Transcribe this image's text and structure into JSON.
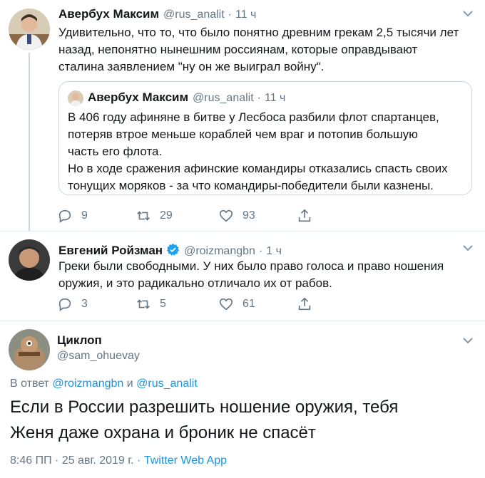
{
  "tweet1": {
    "name": "Авербух Максим",
    "handle": "@rus_analit",
    "time": "11 ч",
    "lines": [
      "Удивительно, что то, что было понятно древним грекам 2,5 тысячи лет",
      "назад, непонятно нынешним россиянам, которые оправдывают",
      "сталина заявлением \"ну он же выиграл войну\"."
    ],
    "quote": {
      "name": "Авербух Максим",
      "handle": "@rus_analit",
      "time": "11 ч",
      "lines": [
        "В 406 году афиняне в битве у Лесбоса разбили флот спартанцев,",
        "потеряв втрое меньше кораблей чем враг и потопив большую",
        "часть его флота.",
        "Но в ходе сражения афинские командиры отказались спасть своих",
        "тонущих моряков - за что командиры-победители были казнены."
      ]
    },
    "replies": "9",
    "retweets": "29",
    "likes": "93"
  },
  "tweet2": {
    "name": "Евгений Ройзман",
    "handle": "@roizmangbn",
    "time": "1 ч",
    "lines": [
      "Греки были свободными. У них было право голоса и право ношения",
      "оружия, и это радикально отличало их от рабов."
    ],
    "replies": "3",
    "retweets": "5",
    "likes": "61"
  },
  "tweet3": {
    "name": "Циклоп",
    "handle": "@sam_ohuevay",
    "reply_prefix": "В ответ",
    "reply_mention1": "@roizmangbn",
    "reply_and": "и",
    "reply_mention2": "@rus_analit",
    "lines": [
      "Если в России разрешить ношение оружия, тебя",
      "Женя даже охрана и броник не спасёт"
    ],
    "timestamp": "8:46 ПП · 25 авг. 2019 г. ·",
    "app": "Twitter Web App"
  },
  "colors": {
    "accent": "#1b95e0",
    "verified": "#1da1f2",
    "secondary": "#657786"
  }
}
